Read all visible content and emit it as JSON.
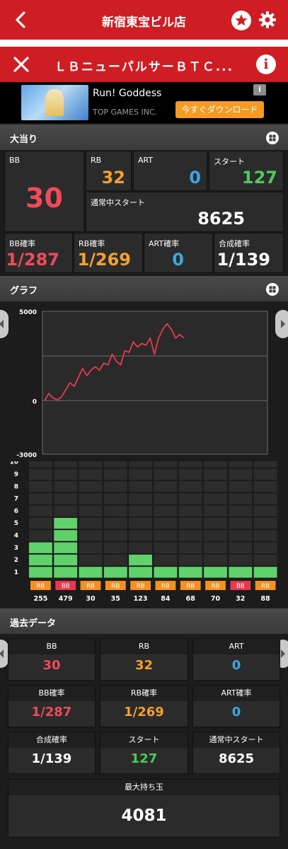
{
  "header": {
    "store_name": "新宿東宝ビル店"
  },
  "machine": {
    "name": "ＬＢニューパルサーＢＴＣ..."
  },
  "ad": {
    "app_name": "Run! Goddess",
    "developer": "TOP GAMES INC.",
    "cta": "今すぐダウンロード",
    "info_badge": "i"
  },
  "jackpot": {
    "title": "大当り",
    "bb": {
      "label": "BB",
      "value": "30"
    },
    "rb": {
      "label": "RB",
      "value": "32"
    },
    "art": {
      "label": "ART",
      "value": "0"
    },
    "start": {
      "label": "スタート",
      "value": "127"
    },
    "normal_start": {
      "label": "通常中スタート",
      "value": "8625"
    },
    "bb_rate": {
      "label": "BB確率",
      "value": "1/287"
    },
    "rb_rate": {
      "label": "RB確率",
      "value": "1/269"
    },
    "art_rate": {
      "label": "ART確率",
      "value": "0"
    },
    "total_rate": {
      "label": "合成確率",
      "value": "1/139"
    }
  },
  "graph": {
    "title": "グラフ"
  },
  "chart_data": [
    {
      "type": "line",
      "yticks": [
        "5000",
        "0",
        "-3000"
      ],
      "ylim": [
        -3000,
        5000
      ],
      "series": [
        {
          "color": "#e8384f",
          "values": [
            0,
            400,
            150,
            50,
            200,
            600,
            1000,
            800,
            1300,
            1800,
            1400,
            1700,
            1900,
            1700,
            2100,
            2000,
            2600,
            2200,
            2000,
            2800,
            2700,
            3300,
            3000,
            3200,
            3100,
            3500,
            2600,
            3500,
            4000,
            4300,
            4000,
            3500,
            3700,
            3500
          ]
        }
      ]
    },
    {
      "type": "bar",
      "yticks": [
        "1",
        "2",
        "3",
        "4",
        "5",
        "6",
        "7",
        "8",
        "9",
        "10"
      ],
      "ylim": [
        0,
        10
      ],
      "categories": [
        "RB",
        "BB",
        "RB",
        "RB",
        "RB",
        "RB",
        "RB",
        "RB",
        "BB",
        "RB"
      ],
      "values": [
        3,
        5,
        1,
        1,
        2,
        1,
        1,
        1,
        1,
        1
      ],
      "games": [
        "255",
        "479",
        "30",
        "35",
        "123",
        "84",
        "68",
        "70",
        "32",
        "88"
      ],
      "type_colors": {
        "RB": "#f5901e",
        "BB": "#e8384f"
      },
      "bar_color": "#5fd26c"
    }
  ],
  "past_data": {
    "title": "過去データ",
    "cells": [
      {
        "label": "BB",
        "value": "30",
        "color": "red"
      },
      {
        "label": "RB",
        "value": "32",
        "color": "orange"
      },
      {
        "label": "ART",
        "value": "0",
        "color": "blue"
      },
      {
        "label": "BB確率",
        "value": "1/287",
        "color": "red"
      },
      {
        "label": "RB確率",
        "value": "1/269",
        "color": "orange"
      },
      {
        "label": "ART確率",
        "value": "0",
        "color": "blue"
      },
      {
        "label": "合成確率",
        "value": "1/139",
        "color": "white"
      },
      {
        "label": "スタート",
        "value": "127",
        "color": "green"
      },
      {
        "label": "通常中スタート",
        "value": "8625",
        "color": "white"
      }
    ],
    "max_balls": {
      "label": "最大持ち玉",
      "value": "4081"
    }
  }
}
